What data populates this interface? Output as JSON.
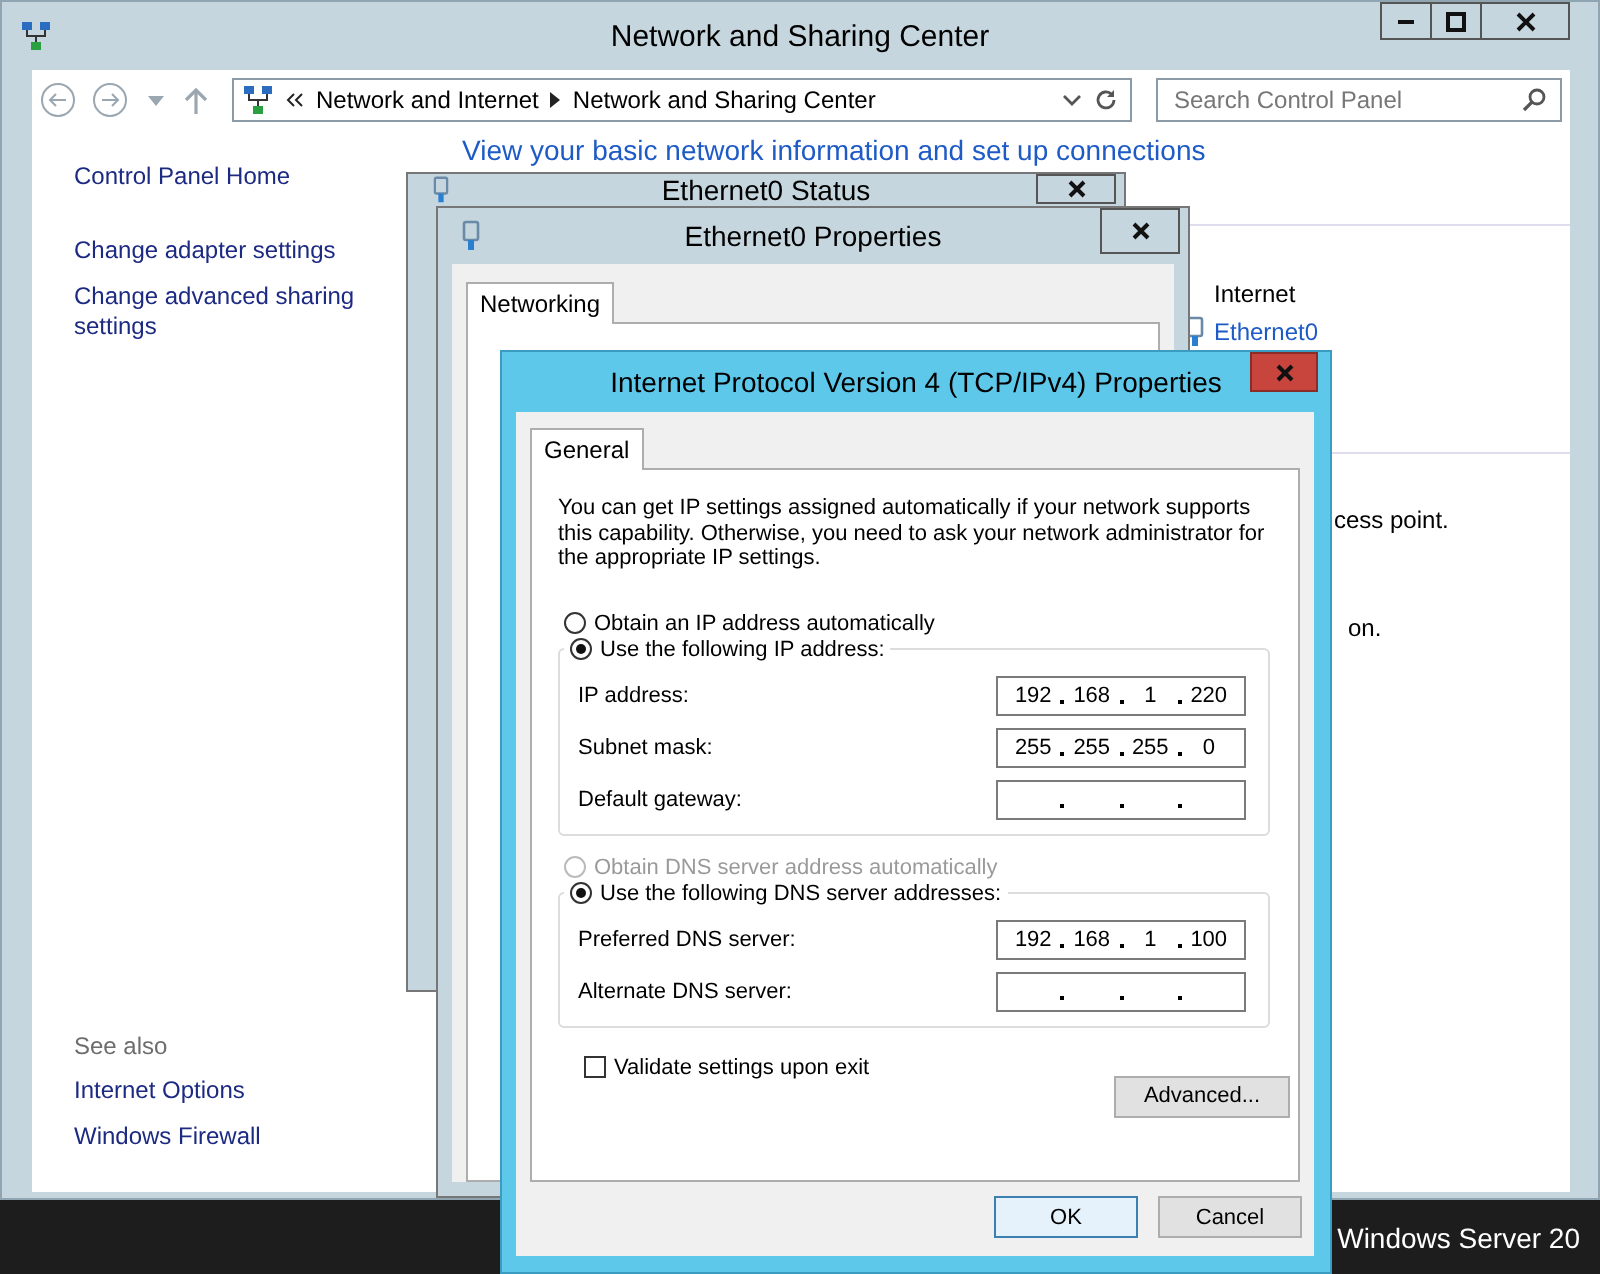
{
  "main_window": {
    "title": "Network and Sharing Center",
    "breadcrumb": [
      "Network and Internet",
      "Network and Sharing Center"
    ],
    "search": {
      "placeholder": "Search Control Panel"
    },
    "sidebar": {
      "items": [
        "Control Panel Home",
        "Change adapter settings",
        "Change advanced sharing settings"
      ],
      "see_also_label": "See also",
      "see_also": [
        "Internet Options",
        "Windows Firewall"
      ]
    },
    "heading": "View your basic network information and set up connections",
    "connection_label": "Internet",
    "connection_link": "Ethernet0",
    "text_fragments": [
      "cess point.",
      "on."
    ]
  },
  "status_window": {
    "title": "Ethernet0 Status"
  },
  "properties_window": {
    "title": "Ethernet0 Properties",
    "tabs": [
      {
        "label": "Networking",
        "selected": true
      }
    ]
  },
  "ipv4_dialog": {
    "title": "Internet Protocol Version 4 (TCP/IPv4) Properties",
    "tabs": [
      {
        "label": "General",
        "selected": true
      }
    ],
    "intro": "You can get IP settings assigned automatically if your network supports this capability. Otherwise, you need to ask your network administrator for the appropriate IP settings.",
    "ip_options": [
      {
        "label": "Obtain an IP address automatically",
        "selected": false,
        "disabled": false
      },
      {
        "label": "Use the following IP address:",
        "selected": true,
        "disabled": false
      }
    ],
    "ip_fields": [
      {
        "label": "IP address:",
        "octets": [
          "192",
          "168",
          "1",
          "220"
        ]
      },
      {
        "label": "Subnet mask:",
        "octets": [
          "255",
          "255",
          "255",
          "0"
        ]
      },
      {
        "label": "Default gateway:"
      }
    ],
    "dns_options": [
      {
        "label": "Obtain DNS server address automatically",
        "selected": false,
        "disabled": true
      },
      {
        "label": "Use the following DNS server addresses:",
        "selected": true,
        "disabled": false
      }
    ],
    "dns_fields": [
      {
        "label": "Preferred DNS server:",
        "octets": [
          "192",
          "168",
          "1",
          "100"
        ]
      },
      {
        "label": "Alternate DNS server:"
      }
    ],
    "validate": {
      "label": "Validate settings upon exit",
      "checked": false
    },
    "advanced_button": "Advanced...",
    "buttons": [
      {
        "label": "OK",
        "default": true
      },
      {
        "label": "Cancel",
        "default": false
      }
    ]
  },
  "taskbar": {
    "text": "Windows Server 20"
  }
}
